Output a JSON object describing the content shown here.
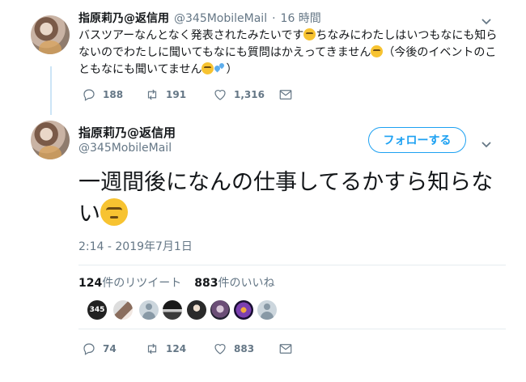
{
  "tweet1": {
    "author_name": "指原莉乃@返信用",
    "author_handle": "@345MobileMail",
    "time_sep": "·",
    "time": "16 時間",
    "text_part1": "バスツアーなんとなく発表されたみたいです",
    "text_part2": "ちなみにわたしはいつもなにも知らないのでわたしに聞いてもなにも質問はかえってきません",
    "text_part3": "（今後のイベントのこともなにも聞いてません",
    "text_part4": "）",
    "replies": "188",
    "retweets": "191",
    "likes": "1,316"
  },
  "tweet2": {
    "author_name": "指原莉乃@返信用",
    "author_handle": "@345MobileMail",
    "follow_label": "フォローする",
    "text": "一週間後になんの仕事してるかすら知らない",
    "timestamp": "2:14 - 2019年7月1日",
    "retweet_count": "124",
    "retweet_label": "件のリツイート",
    "like_count": "883",
    "like_label": "件のいいね",
    "liker_badge": "345",
    "replies": "74",
    "retweets": "124",
    "likes": "883"
  },
  "icons": {
    "reply": "reply-icon",
    "retweet": "retweet-icon",
    "like": "heart-icon",
    "dm": "envelope-icon",
    "caret": "chevron-down-icon"
  },
  "colors": {
    "accent": "#1da1f2",
    "muted": "#657786",
    "thread": "#cce5f6"
  }
}
